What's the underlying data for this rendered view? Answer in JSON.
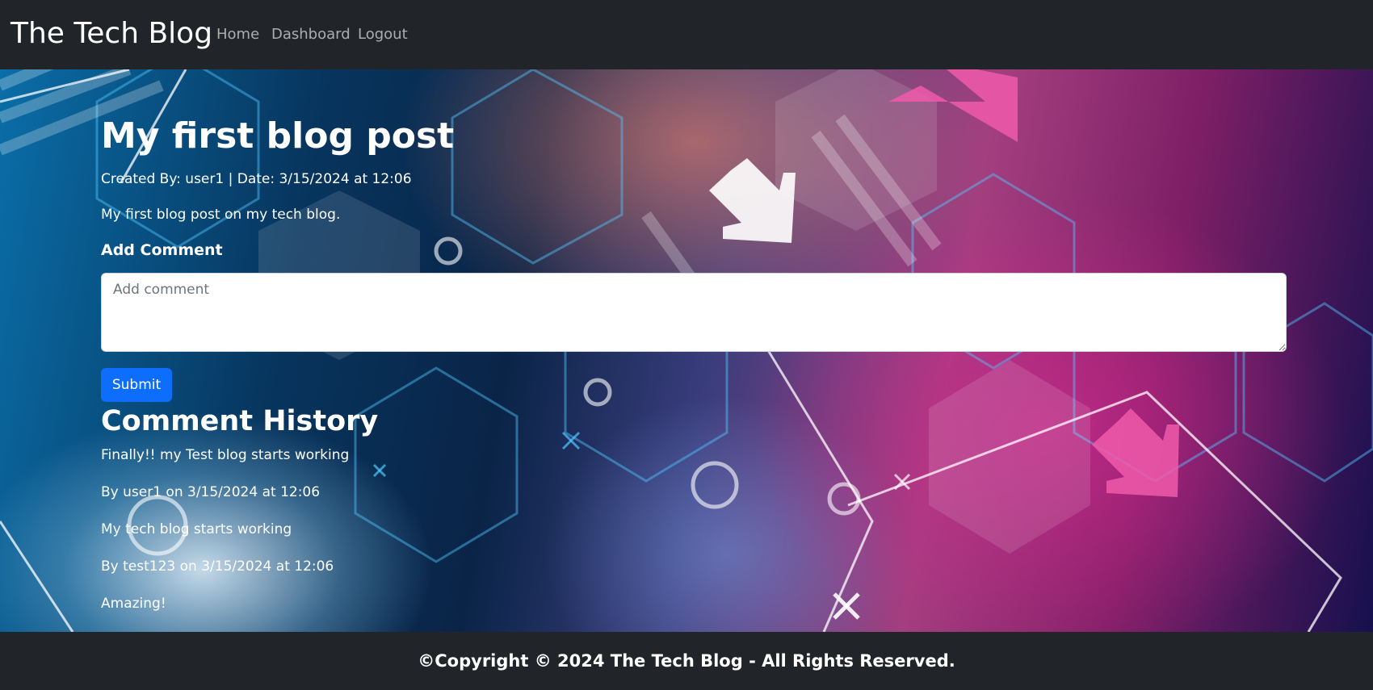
{
  "navbar": {
    "brand": "The Tech Blog",
    "links": [
      "Home",
      "Dashboard",
      "Logout"
    ]
  },
  "post": {
    "title": "My first blog post",
    "meta": "Created By: user1 | Date: 3/15/2024 at 12:06",
    "body": "My first blog post on my tech blog."
  },
  "comment_form": {
    "label": "Add Comment",
    "placeholder": "Add comment",
    "value": "",
    "submit_label": "Submit"
  },
  "history": {
    "title": "Comment History",
    "comments": [
      {
        "text": "Finally!! my Test blog starts working",
        "byline": "By user1 on 3/15/2024 at 12:06"
      },
      {
        "text": "My tech blog starts working",
        "byline": "By test123 on 3/15/2024 at 12:06"
      },
      {
        "text": "Amazing!"
      }
    ]
  },
  "footer": {
    "text": "©Copyright © 2024 The Tech Blog - All Rights Reserved."
  },
  "colors": {
    "navbar_bg": "#212529",
    "submit_bg": "#0d6efd",
    "text": "#ffffff"
  }
}
